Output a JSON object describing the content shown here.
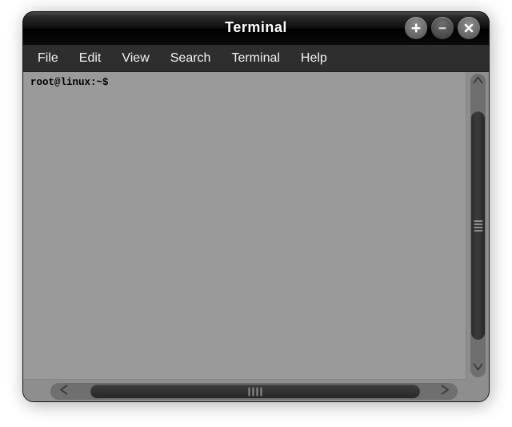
{
  "window": {
    "title": "Terminal",
    "controls": [
      {
        "name": "maximize-button",
        "glyph": "plus"
      },
      {
        "name": "minimize-button",
        "glyph": "minus"
      },
      {
        "name": "close-button",
        "glyph": "x"
      }
    ]
  },
  "menubar": {
    "items": [
      {
        "label": "File"
      },
      {
        "label": "Edit"
      },
      {
        "label": "View"
      },
      {
        "label": "Search"
      },
      {
        "label": "Terminal"
      },
      {
        "label": "Help"
      }
    ]
  },
  "terminal": {
    "prompt": "root@linux:~$",
    "background_color": "#9a9a9a",
    "text_color": "#000000"
  },
  "scrollbars": {
    "vertical": {
      "up_arrow_icon": "chevron-up-icon",
      "down_arrow_icon": "chevron-down-icon",
      "grip_lines": 4
    },
    "horizontal": {
      "left_arrow_icon": "chevron-left-icon",
      "right_arrow_icon": "chevron-right-icon",
      "grip_lines": 4
    }
  },
  "colors": {
    "titlebar": "#000000",
    "menubar": "#2e2e2e",
    "terminal_bg": "#9a9a9a",
    "scrollbar_track": "#6f6f6f",
    "scrollbar_thumb": "#333333"
  }
}
